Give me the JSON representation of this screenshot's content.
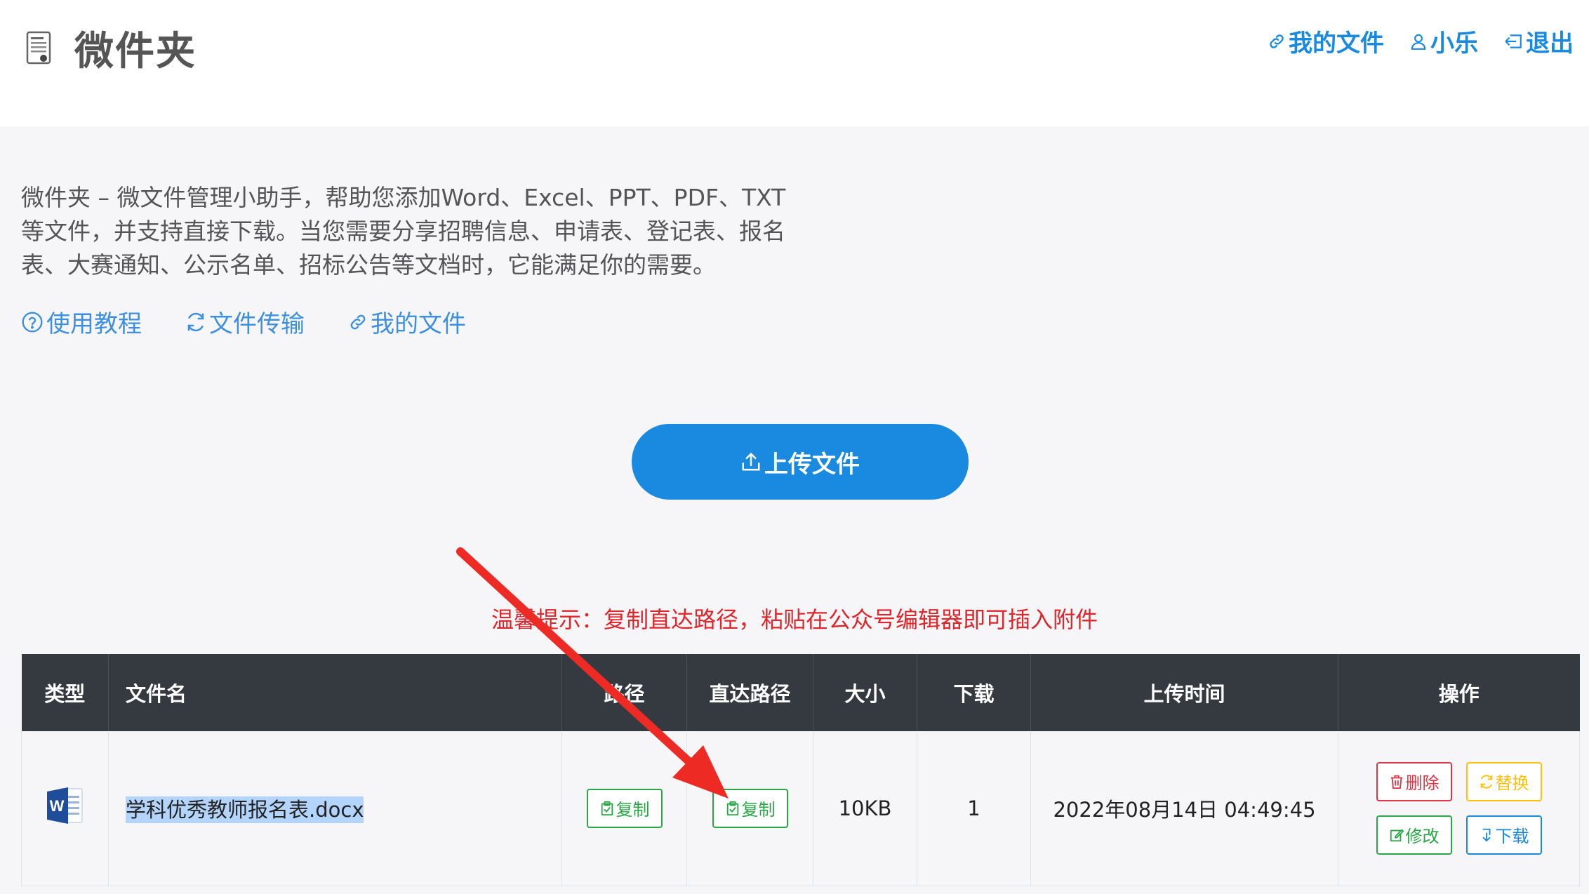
{
  "header": {
    "title": "微件夹",
    "nav": [
      {
        "label": "我的文件",
        "icon": "link-icon"
      },
      {
        "label": "小乐",
        "icon": "user-icon"
      },
      {
        "label": "退出",
        "icon": "logout-icon"
      }
    ]
  },
  "intro": {
    "line1": "微件夹 – 微文件管理小助手，帮助您添加Word、Excel、PPT、PDF、TXT",
    "line2": "等文件，并支持直接下载。当您需要分享招聘信息、申请表、登记表、报名",
    "line3": "表、大赛通知、公示名单、招标公告等文档时，它能满足你的需要。"
  },
  "quick_links": [
    {
      "label": "使用教程",
      "icon": "help-circle-icon"
    },
    {
      "label": "文件传输",
      "icon": "refresh-icon"
    },
    {
      "label": "我的文件",
      "icon": "link-icon"
    }
  ],
  "upload": {
    "label": "上传文件",
    "icon": "upload-icon"
  },
  "tip": "温馨提示：复制直达路径，粘贴在公众号编辑器即可插入附件",
  "table": {
    "headers": {
      "type": "类型",
      "name": "文件名",
      "path": "路径",
      "direct": "直达路径",
      "size": "大小",
      "downloads": "下载",
      "time": "上传时间",
      "actions": "操作"
    },
    "rows": [
      {
        "type_icon": "word-icon",
        "name": "学科优秀教师报名表.docx",
        "path_btn": "复制",
        "direct_btn": "复制",
        "size": "10KB",
        "downloads": "1",
        "time": "2022年08月14日 04:49:45",
        "actions": {
          "delete": "删除",
          "replace": "替换",
          "edit": "修改",
          "download": "下载"
        }
      }
    ]
  },
  "colors": {
    "accent": "#1a8ae0",
    "danger": "#dc3545",
    "warning": "#ffc107",
    "success": "#28a745",
    "tip": "#e0262b",
    "annotation": "#ee2a24"
  }
}
